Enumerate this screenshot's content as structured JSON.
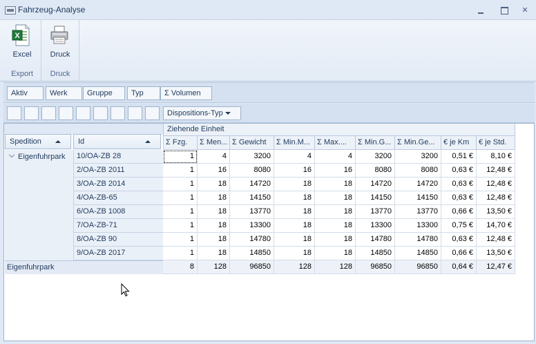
{
  "window": {
    "title": "Fahrzeug-Analyse"
  },
  "ribbon": {
    "excel_label": "Excel",
    "export_group": "Export",
    "druck_label": "Druck",
    "druck_group": "Druck"
  },
  "filter_fields": [
    "Aktiv",
    "Werk",
    "Gruppe",
    "Typ",
    "Σ Volumen"
  ],
  "column_area": {
    "dispo_label": "Dispositions-Typ"
  },
  "row_fields": {
    "spedition": "Spedition",
    "id": "Id"
  },
  "column_group": "Ziehende Einheit",
  "data_headers": [
    "Σ Fzg.",
    "Σ Men...",
    "Σ Gewicht",
    "Σ Min.M...",
    "Σ Max....",
    "Σ Min.G...",
    "Σ Min.Ge...",
    "€ je Km",
    "€ je Std."
  ],
  "group_name": "Eigenfuhrpark",
  "rows": [
    {
      "id": "10/OA-ZB 28",
      "values": [
        "1",
        "4",
        "3200",
        "4",
        "4",
        "3200",
        "3200",
        "0,51 €",
        "8,10 €"
      ]
    },
    {
      "id": "2/OA-ZB 2011",
      "values": [
        "1",
        "16",
        "8080",
        "16",
        "16",
        "8080",
        "8080",
        "0,63 €",
        "12,48 €"
      ]
    },
    {
      "id": "3/OA-ZB 2014",
      "values": [
        "1",
        "18",
        "14720",
        "18",
        "18",
        "14720",
        "14720",
        "0,63 €",
        "12,48 €"
      ]
    },
    {
      "id": "4/OA-ZB-65",
      "values": [
        "1",
        "18",
        "14150",
        "18",
        "18",
        "14150",
        "14150",
        "0,63 €",
        "12,48 €"
      ]
    },
    {
      "id": "6/OA-ZB 1008",
      "values": [
        "1",
        "18",
        "13770",
        "18",
        "18",
        "13770",
        "13770",
        "0,66 €",
        "13,50 €"
      ]
    },
    {
      "id": "7/OA-ZB-71",
      "values": [
        "1",
        "18",
        "13300",
        "18",
        "18",
        "13300",
        "13300",
        "0,75 €",
        "14,70 €"
      ]
    },
    {
      "id": "8/OA-ZB 90",
      "values": [
        "1",
        "18",
        "14780",
        "18",
        "18",
        "14780",
        "14780",
        "0,63 €",
        "12,48 €"
      ]
    },
    {
      "id": "9/OA-ZB 2017",
      "values": [
        "1",
        "18",
        "14850",
        "18",
        "18",
        "14850",
        "14850",
        "0,66 €",
        "13,50 €"
      ]
    }
  ],
  "total": {
    "label": "Eigenfuhrpark",
    "values": [
      "8",
      "128",
      "96850",
      "128",
      "128",
      "96850",
      "96850",
      "0,64 €",
      "12,47 €"
    ]
  }
}
